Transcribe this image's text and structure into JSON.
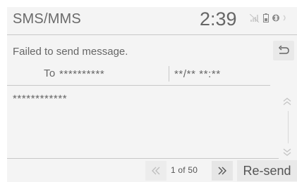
{
  "header": {
    "title": "SMS/MMS",
    "clock": "2:39",
    "icons": [
      "signal-icon",
      "battery-icon",
      "bluetooth-icon"
    ]
  },
  "message": {
    "status": "Failed to send message.",
    "to_label": "To",
    "to_number": "**********",
    "timestamp": "**/** **:**",
    "body": "************"
  },
  "toolbar": {
    "back_icon": "back-arrow-icon",
    "prev_icon": "double-chevron-left-icon",
    "page_counter": "1 of 50",
    "next_icon": "double-chevron-right-icon",
    "resend_label": "Re-send"
  },
  "scroll": {
    "up_icon": "chevron-up-icon",
    "down_icon": "chevron-down-icon"
  },
  "colors": {
    "background": "#f4f4f4",
    "divider": "#c8c8c8",
    "text": "#666666",
    "button": "#e9e9e9"
  }
}
